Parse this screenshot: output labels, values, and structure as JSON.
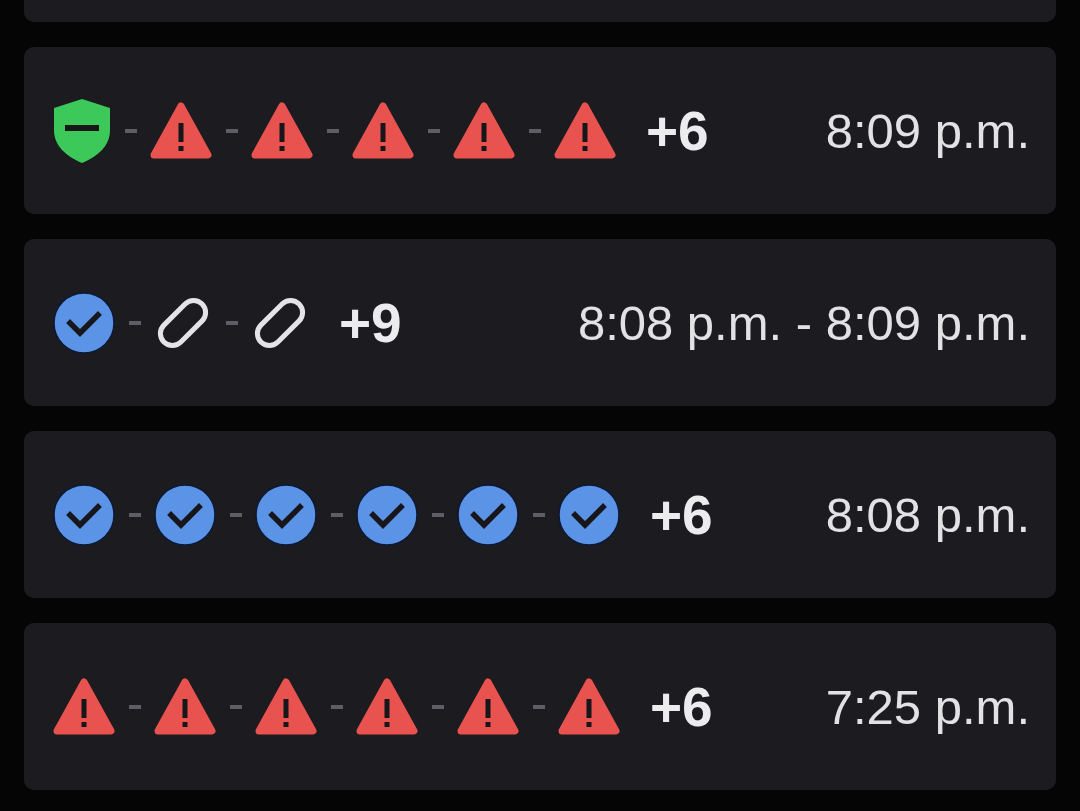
{
  "partial_card_above": true,
  "events": [
    {
      "icons": [
        {
          "kind": "shield"
        },
        {
          "kind": "warning"
        },
        {
          "kind": "warning"
        },
        {
          "kind": "warning"
        },
        {
          "kind": "warning"
        },
        {
          "kind": "warning"
        }
      ],
      "more": "+6",
      "time": "8:09 p.m."
    },
    {
      "icons": [
        {
          "kind": "check"
        },
        {
          "kind": "link"
        },
        {
          "kind": "link"
        }
      ],
      "more": "+9",
      "time": "8:08 p.m. - 8:09 p.m."
    },
    {
      "icons": [
        {
          "kind": "check"
        },
        {
          "kind": "check"
        },
        {
          "kind": "check"
        },
        {
          "kind": "check"
        },
        {
          "kind": "check"
        },
        {
          "kind": "check"
        }
      ],
      "more": "+6",
      "time": "8:08 p.m."
    },
    {
      "icons": [
        {
          "kind": "warning"
        },
        {
          "kind": "warning"
        },
        {
          "kind": "warning"
        },
        {
          "kind": "warning"
        },
        {
          "kind": "warning"
        },
        {
          "kind": "warning"
        }
      ],
      "more": "+6",
      "time": "7:25 p.m."
    }
  ]
}
